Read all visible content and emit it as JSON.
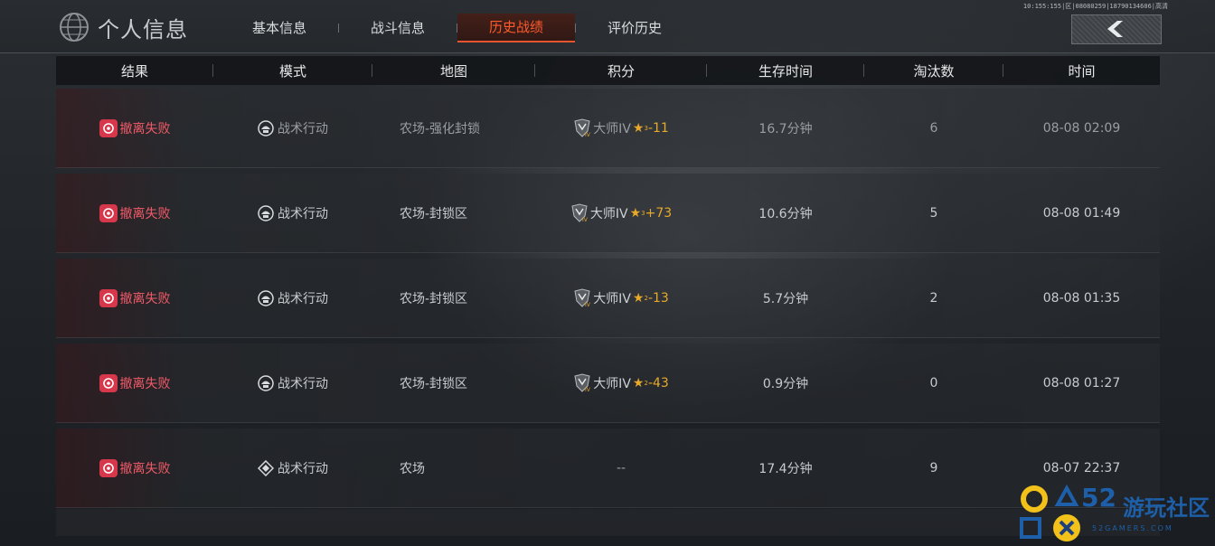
{
  "header": {
    "title": "个人信息",
    "tabs": [
      {
        "label": "基本信息",
        "active": false
      },
      {
        "label": "战斗信息",
        "active": false
      },
      {
        "label": "历史战绩",
        "active": true
      },
      {
        "label": "评价历史",
        "active": false
      }
    ],
    "status_line": "10:155:155|区|08080259|18790134606|高清"
  },
  "table": {
    "columns": [
      "结果",
      "模式",
      "地图",
      "积分",
      "生存时间",
      "淘汰数",
      "时间"
    ],
    "rows": [
      {
        "result": "撤离失败",
        "mode": "战术行动",
        "map": "农场-强化封锁",
        "rank": "大师IV",
        "star_level": "3",
        "score": "-11",
        "survival": "16.7分钟",
        "kills": "6",
        "time": "08-08 02:09",
        "dimmed": true
      },
      {
        "result": "撤离失败",
        "mode": "战术行动",
        "map": "农场-封锁区",
        "rank": "大师IV",
        "star_level": "3",
        "score": "+73",
        "survival": "10.6分钟",
        "kills": "5",
        "time": "08-08 01:49",
        "dimmed": false
      },
      {
        "result": "撤离失败",
        "mode": "战术行动",
        "map": "农场-封锁区",
        "rank": "大师IV",
        "star_level": "2",
        "score": "-13",
        "survival": "5.7分钟",
        "kills": "2",
        "time": "08-08 01:35",
        "dimmed": false
      },
      {
        "result": "撤离失败",
        "mode": "战术行动",
        "map": "农场-封锁区",
        "rank": "大师IV",
        "star_level": "2",
        "score": "-43",
        "survival": "0.9分钟",
        "kills": "0",
        "time": "08-08 01:27",
        "dimmed": false
      },
      {
        "result": "撤离失败",
        "mode": "战术行动",
        "map": "农场",
        "rank": "",
        "star_level": "",
        "score": "--",
        "survival": "17.4分钟",
        "kills": "9",
        "time": "08-07 22:37",
        "dimmed": false
      }
    ]
  },
  "watermark": {
    "number": "52",
    "name": "游玩社区",
    "domain": "52GAMERS.COM"
  },
  "colors": {
    "accent": "#e5552f",
    "fail_red": "#f05a68",
    "score_gold": "#e8a92a"
  },
  "icons": {
    "back": "chevron-left-icon",
    "title": "globe-icon",
    "result": "fail-badge-icon",
    "mode": "helmet-icon",
    "rank": "rank-badge-icon"
  }
}
